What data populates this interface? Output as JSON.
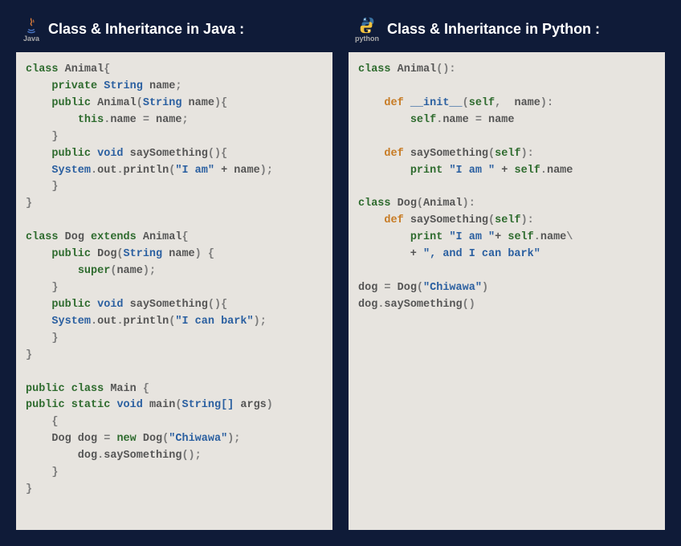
{
  "left": {
    "icon_label": "Java",
    "title": "Class & Inheritance in Java :",
    "code_lines": [
      [
        [
          "kw",
          "class"
        ],
        [
          "id",
          " Animal"
        ],
        [
          "punct",
          "{"
        ]
      ],
      [
        [
          "id",
          "    "
        ],
        [
          "kw",
          "private"
        ],
        [
          "id",
          " "
        ],
        [
          "type",
          "String"
        ],
        [
          "id",
          " name"
        ],
        [
          "punct",
          ";"
        ]
      ],
      [
        [
          "id",
          "    "
        ],
        [
          "kw",
          "public"
        ],
        [
          "id",
          " Animal"
        ],
        [
          "punct",
          "("
        ],
        [
          "type",
          "String"
        ],
        [
          "id",
          " name"
        ],
        [
          "punct",
          ")"
        ],
        [
          "punct",
          "{"
        ]
      ],
      [
        [
          "id",
          "        "
        ],
        [
          "kw",
          "this"
        ],
        [
          "punct",
          "."
        ],
        [
          "id",
          "name "
        ],
        [
          "punct",
          "="
        ],
        [
          "id",
          " name"
        ],
        [
          "punct",
          ";"
        ]
      ],
      [
        [
          "id",
          "    "
        ],
        [
          "punct",
          "}"
        ]
      ],
      [
        [
          "id",
          "    "
        ],
        [
          "kw",
          "public"
        ],
        [
          "id",
          " "
        ],
        [
          "type",
          "void"
        ],
        [
          "id",
          " saySomething"
        ],
        [
          "punct",
          "()"
        ],
        [
          "punct",
          "{"
        ]
      ],
      [
        [
          "id",
          "    "
        ],
        [
          "type",
          "System"
        ],
        [
          "punct",
          "."
        ],
        [
          "id",
          "out"
        ],
        [
          "punct",
          "."
        ],
        [
          "id",
          "println"
        ],
        [
          "punct",
          "("
        ],
        [
          "str",
          "\"I am\""
        ],
        [
          "id",
          " + name"
        ],
        [
          "punct",
          ")"
        ],
        [
          "punct",
          ";"
        ]
      ],
      [
        [
          "id",
          "    "
        ],
        [
          "punct",
          "}"
        ]
      ],
      [
        [
          "punct",
          "}"
        ]
      ],
      [
        [
          "id",
          " "
        ]
      ],
      [
        [
          "kw",
          "class"
        ],
        [
          "id",
          " Dog "
        ],
        [
          "kw",
          "extends"
        ],
        [
          "id",
          " Animal"
        ],
        [
          "punct",
          "{"
        ]
      ],
      [
        [
          "id",
          "    "
        ],
        [
          "kw",
          "public"
        ],
        [
          "id",
          " Dog"
        ],
        [
          "punct",
          "("
        ],
        [
          "type",
          "String"
        ],
        [
          "id",
          " name"
        ],
        [
          "punct",
          ")"
        ],
        [
          "id",
          " "
        ],
        [
          "punct",
          "{"
        ]
      ],
      [
        [
          "id",
          "        "
        ],
        [
          "kw",
          "super"
        ],
        [
          "punct",
          "("
        ],
        [
          "id",
          "name"
        ],
        [
          "punct",
          ")"
        ],
        [
          "punct",
          ";"
        ]
      ],
      [
        [
          "id",
          "    "
        ],
        [
          "punct",
          "}"
        ]
      ],
      [
        [
          "id",
          "    "
        ],
        [
          "kw",
          "public"
        ],
        [
          "id",
          " "
        ],
        [
          "type",
          "void"
        ],
        [
          "id",
          " saySomething"
        ],
        [
          "punct",
          "()"
        ],
        [
          "punct",
          "{"
        ]
      ],
      [
        [
          "id",
          "    "
        ],
        [
          "type",
          "System"
        ],
        [
          "punct",
          "."
        ],
        [
          "id",
          "out"
        ],
        [
          "punct",
          "."
        ],
        [
          "id",
          "println"
        ],
        [
          "punct",
          "("
        ],
        [
          "str",
          "\"I can bark\""
        ],
        [
          "punct",
          ")"
        ],
        [
          "punct",
          ";"
        ]
      ],
      [
        [
          "id",
          "    "
        ],
        [
          "punct",
          "}"
        ]
      ],
      [
        [
          "punct",
          "}"
        ]
      ],
      [
        [
          "id",
          " "
        ]
      ],
      [
        [
          "kw",
          "public"
        ],
        [
          "id",
          " "
        ],
        [
          "kw",
          "class"
        ],
        [
          "id",
          " Main "
        ],
        [
          "punct",
          "{"
        ]
      ],
      [
        [
          "kw",
          "public"
        ],
        [
          "id",
          " "
        ],
        [
          "kw",
          "static"
        ],
        [
          "id",
          " "
        ],
        [
          "type",
          "void"
        ],
        [
          "id",
          " main"
        ],
        [
          "punct",
          "("
        ],
        [
          "type",
          "String[]"
        ],
        [
          "id",
          " args"
        ],
        [
          "punct",
          ")"
        ]
      ],
      [
        [
          "id",
          "    "
        ],
        [
          "punct",
          "{"
        ]
      ],
      [
        [
          "id",
          "    Dog dog "
        ],
        [
          "punct",
          "="
        ],
        [
          "id",
          " "
        ],
        [
          "kw",
          "new"
        ],
        [
          "id",
          " Dog"
        ],
        [
          "punct",
          "("
        ],
        [
          "str",
          "\"Chiwawa\""
        ],
        [
          "punct",
          ")"
        ],
        [
          "punct",
          ";"
        ]
      ],
      [
        [
          "id",
          "        dog"
        ],
        [
          "punct",
          "."
        ],
        [
          "id",
          "saySomething"
        ],
        [
          "punct",
          "()"
        ],
        [
          "punct",
          ";"
        ]
      ],
      [
        [
          "id",
          "    "
        ],
        [
          "punct",
          "}"
        ]
      ],
      [
        [
          "punct",
          "}"
        ]
      ]
    ]
  },
  "right": {
    "icon_label": "python",
    "title": "Class & Inheritance in Python :",
    "code_lines": [
      [
        [
          "kw",
          "class"
        ],
        [
          "id",
          " Animal"
        ],
        [
          "punct",
          "():"
        ]
      ],
      [
        [
          "id",
          " "
        ]
      ],
      [
        [
          "id",
          "    "
        ],
        [
          "def",
          "def"
        ],
        [
          "id",
          " "
        ],
        [
          "type",
          "__init__"
        ],
        [
          "punct",
          "("
        ],
        [
          "kw",
          "self"
        ],
        [
          "punct",
          ",  "
        ],
        [
          "id",
          "name"
        ],
        [
          "punct",
          "):"
        ]
      ],
      [
        [
          "id",
          "        "
        ],
        [
          "kw",
          "self"
        ],
        [
          "punct",
          "."
        ],
        [
          "id",
          "name "
        ],
        [
          "punct",
          "="
        ],
        [
          "id",
          " name"
        ]
      ],
      [
        [
          "id",
          " "
        ]
      ],
      [
        [
          "id",
          "    "
        ],
        [
          "def",
          "def"
        ],
        [
          "id",
          " saySomething"
        ],
        [
          "punct",
          "("
        ],
        [
          "kw",
          "self"
        ],
        [
          "punct",
          "):"
        ]
      ],
      [
        [
          "id",
          "        "
        ],
        [
          "kw",
          "print"
        ],
        [
          "id",
          " "
        ],
        [
          "str",
          "\"I am \""
        ],
        [
          "id",
          " + "
        ],
        [
          "kw",
          "self"
        ],
        [
          "punct",
          "."
        ],
        [
          "id",
          "name"
        ]
      ],
      [
        [
          "id",
          " "
        ]
      ],
      [
        [
          "kw",
          "class"
        ],
        [
          "id",
          " Dog"
        ],
        [
          "punct",
          "("
        ],
        [
          "id",
          "Animal"
        ],
        [
          "punct",
          "):"
        ]
      ],
      [
        [
          "id",
          "    "
        ],
        [
          "def",
          "def"
        ],
        [
          "id",
          " saySomething"
        ],
        [
          "punct",
          "("
        ],
        [
          "kw",
          "self"
        ],
        [
          "punct",
          "):"
        ]
      ],
      [
        [
          "id",
          "        "
        ],
        [
          "kw",
          "print"
        ],
        [
          "id",
          " "
        ],
        [
          "str",
          "\"I am \""
        ],
        [
          "id",
          "+ "
        ],
        [
          "kw",
          "self"
        ],
        [
          "punct",
          "."
        ],
        [
          "id",
          "name"
        ],
        [
          "punct",
          "\\"
        ]
      ],
      [
        [
          "id",
          "        + "
        ],
        [
          "str",
          "\", and I can bark\""
        ]
      ],
      [
        [
          "id",
          " "
        ]
      ],
      [
        [
          "id",
          "dog "
        ],
        [
          "punct",
          "="
        ],
        [
          "id",
          " Dog"
        ],
        [
          "punct",
          "("
        ],
        [
          "str",
          "\"Chiwawa\""
        ],
        [
          "punct",
          ")"
        ]
      ],
      [
        [
          "id",
          "dog"
        ],
        [
          "punct",
          "."
        ],
        [
          "id",
          "saySomething"
        ],
        [
          "punct",
          "()"
        ]
      ]
    ]
  }
}
